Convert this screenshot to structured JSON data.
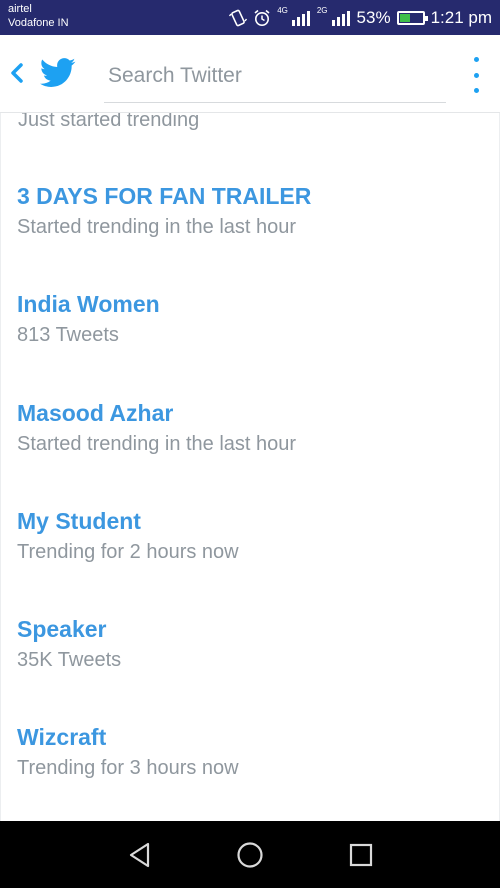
{
  "status_bar": {
    "carrier_1": "airtel",
    "carrier_2": "Vodafone IN",
    "network_1": "4G",
    "network_2": "2G",
    "battery_percent": "53%",
    "battery_level": 0.53,
    "time": "1:21 pm",
    "background_color": "#262a6e"
  },
  "app_bar": {
    "back_icon": "chevron-left-icon",
    "logo_icon": "twitter-bird-icon",
    "search_placeholder": "Search Twitter",
    "overflow_icon": "more-vertical-icon",
    "accent_color": "#1da1f2"
  },
  "trends": {
    "partial_item_subtitle": "Just started trending",
    "items": [
      {
        "name": "3 DAYS FOR FAN TRAILER",
        "subtitle": "Started trending in the last hour"
      },
      {
        "name": "India Women",
        "subtitle": "813 Tweets"
      },
      {
        "name": "Masood Azhar",
        "subtitle": "Started trending in the last hour"
      },
      {
        "name": "My Student",
        "subtitle": "Trending for 2 hours now"
      },
      {
        "name": "Speaker",
        "subtitle": "35K Tweets"
      },
      {
        "name": "Wizcraft",
        "subtitle": "Trending for 3 hours now"
      }
    ],
    "name_color": "#3c97e0",
    "subtitle_color": "#8f979e"
  },
  "nav_bar": {
    "back": "triangle-back-icon",
    "home": "circle-home-icon",
    "recents": "square-recents-icon"
  }
}
